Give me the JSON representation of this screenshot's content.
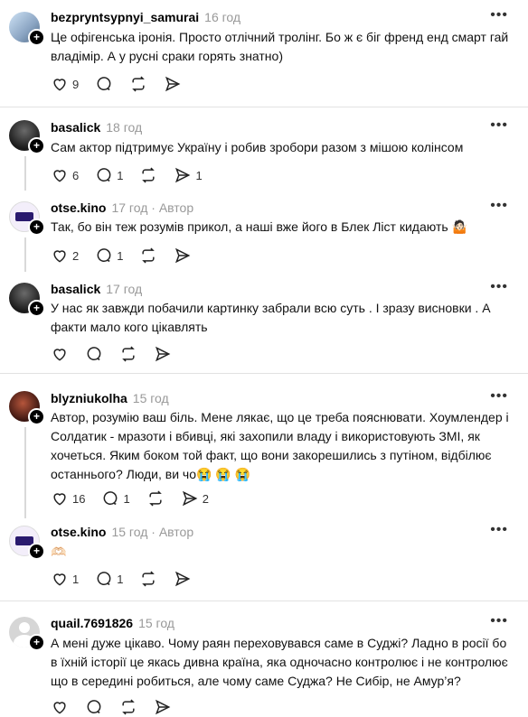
{
  "comments": [
    {
      "username": "bezpryntsypnyi_samurai",
      "time": "16 год",
      "author_tag": "",
      "text": "Це офігенська іронія. Просто отлічний тролінг. Бо ж є біг френд енд смарт гай владімір. А у русні сраки горять знатно)",
      "likes": "9",
      "replies": "",
      "reposts": "",
      "shares": "",
      "avatar": "avatar-landscape"
    },
    {
      "username": "basalick",
      "time": "18 год",
      "author_tag": "",
      "text": "Сам актор підтримує Україну і робив зробори разом з мішою колінсом",
      "likes": "6",
      "replies": "1",
      "reposts": "",
      "shares": "1",
      "avatar": "avatar-dark"
    },
    {
      "username": "otse.kino",
      "time": "17 год",
      "author_tag": "· Автор",
      "text": "Так, бо він теж розумів прикол, а наші вже його в Блек Ліст кидають 🤷🏻",
      "likes": "2",
      "replies": "1",
      "reposts": "",
      "shares": "",
      "avatar": "avatar-brand"
    },
    {
      "username": "basalick",
      "time": "17 год",
      "author_tag": "",
      "text": "У нас як завжди побачили картинку забрали всю суть . І зразу висновки . А факти мало кого цікавлять",
      "likes": "",
      "replies": "",
      "reposts": "",
      "shares": "",
      "avatar": "avatar-dark"
    },
    {
      "username": "blyzniukolha",
      "time": "15 год",
      "author_tag": "",
      "text": "Автор, розумію ваш біль. Мене лякає, що це треба пояснювати. Хоумлендер і Солдатик - мразоти і вбивці, які захопили владу і використовують ЗМІ, як хочеться. Яким боком той факт, що вони закорешились з путіном, відбілює останнього? Люди, ви чо😭 😭 😭",
      "likes": "16",
      "replies": "1",
      "reposts": "",
      "shares": "2",
      "avatar": "avatar-photo"
    },
    {
      "username": "otse.kino",
      "time": "15 год",
      "author_tag": "· Автор",
      "text": "🫶🏻",
      "likes": "1",
      "replies": "1",
      "reposts": "",
      "shares": "",
      "avatar": "avatar-brand"
    },
    {
      "username": "quail.7691826",
      "time": "15 год",
      "author_tag": "",
      "text": "А мені дуже цікаво. Чому раян переховувався саме в Суджі? Ладно в росії бо в їхній історії це якась дивна країна, яка одночасно контролює і не контролює що в середині робиться, але чому саме Суджа? Не Сибір, не Амур’я?",
      "likes": "",
      "replies": "",
      "reposts": "",
      "shares": "",
      "avatar": "avatar-default"
    }
  ],
  "icons": {
    "like": "heart-icon",
    "reply": "comment-icon",
    "repost": "repost-icon",
    "share": "send-icon",
    "more": "more-icon",
    "follow": "plus-icon"
  },
  "more_glyph": "•••",
  "plus_glyph": "+"
}
